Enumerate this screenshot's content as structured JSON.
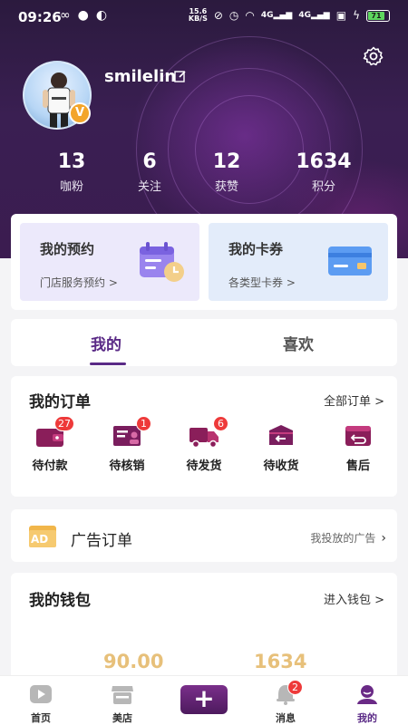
{
  "status_bar": {
    "time": "09:26",
    "speed_top": "15.6",
    "speed_unit": "KB/S",
    "battery": "71",
    "signal_1": "4G",
    "signal_2": "4G"
  },
  "profile": {
    "username": "smilelin",
    "vip_badge": "V"
  },
  "stats": [
    {
      "value": "13",
      "label": "咖粉"
    },
    {
      "value": "6",
      "label": "关注"
    },
    {
      "value": "12",
      "label": "获赞"
    },
    {
      "value": "1634",
      "label": "积分"
    }
  ],
  "quick_links": {
    "booking": {
      "title": "我的预约",
      "sub": "门店服务预约 >"
    },
    "coupons": {
      "title": "我的卡券",
      "sub": "各类型卡券 >"
    }
  },
  "tabs": {
    "mine": "我的",
    "likes": "喜欢",
    "active_color": "#5a2a86"
  },
  "orders": {
    "title": "我的订单",
    "all_link": "全部订单 >",
    "items": [
      {
        "label": "待付款",
        "badge": "27"
      },
      {
        "label": "待核销",
        "badge": "1"
      },
      {
        "label": "待发货",
        "badge": "6"
      },
      {
        "label": "待收货",
        "badge": ""
      },
      {
        "label": "售后",
        "badge": ""
      }
    ]
  },
  "ad": {
    "icon_text": "AD",
    "title": "广告订单",
    "link": "我投放的广告"
  },
  "wallet": {
    "title": "我的钱包",
    "link": "进入钱包 >",
    "balance": "90.00",
    "points": "1634"
  },
  "nav": {
    "home": "首页",
    "store": "美店",
    "plus": "+",
    "messages": "消息",
    "messages_badge": "2",
    "mine": "我的"
  },
  "colors": {
    "brand_purple": "#5a2a86",
    "badge_red": "#ee3a3a",
    "wallet_gold": "#e7c07a"
  }
}
